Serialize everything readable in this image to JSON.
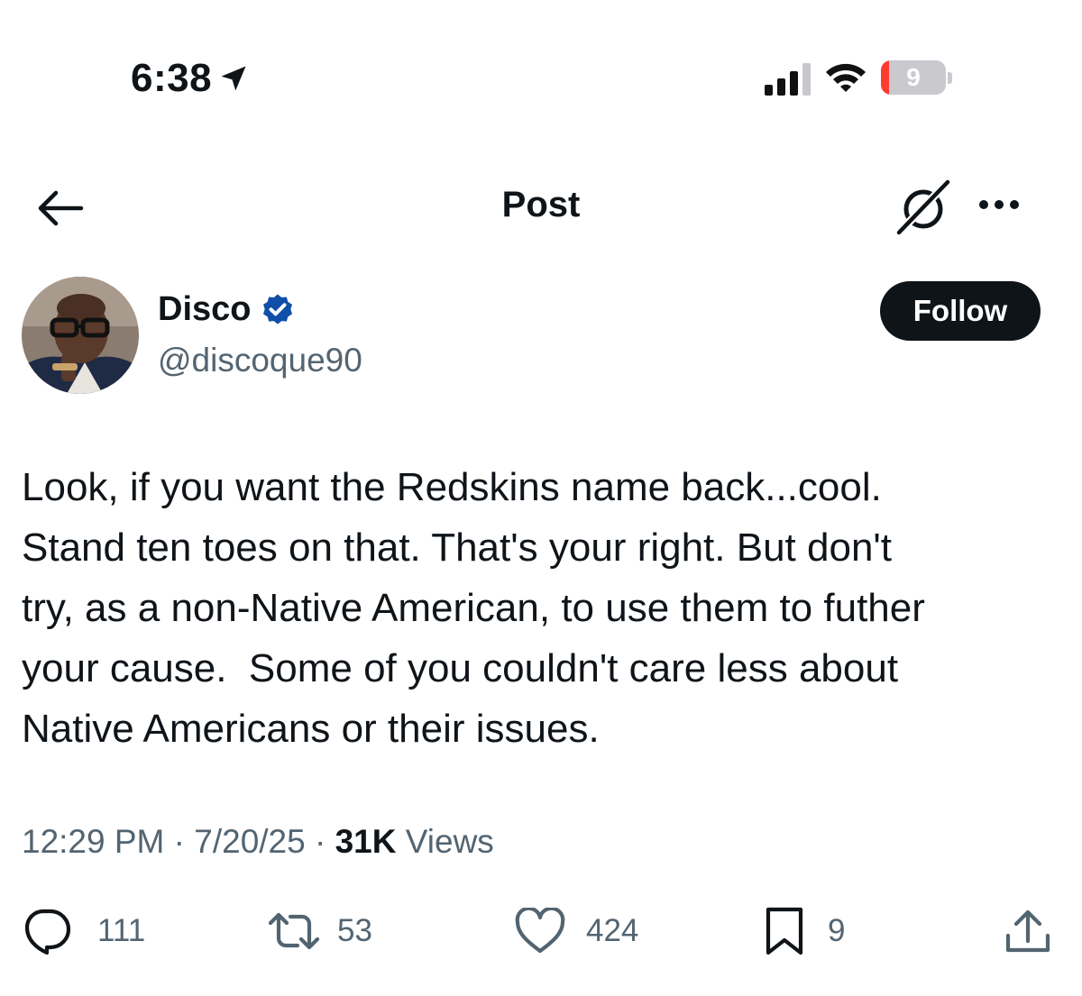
{
  "status_bar": {
    "time": "6:38",
    "battery_level": "9",
    "signal_bars_active": 3,
    "signal_bars_total": 4,
    "icons": [
      "location-arrow-icon",
      "cellular-signal-icon",
      "wifi-icon",
      "battery-icon"
    ]
  },
  "nav": {
    "title": "Post",
    "icons": [
      "back-arrow-icon",
      "grok-icon",
      "more-icon"
    ]
  },
  "author": {
    "name": "Disco",
    "handle": "@discoque90",
    "verified": true,
    "verified_color": "#0f4fa8"
  },
  "follow_button": {
    "label": "Follow"
  },
  "tweet": {
    "lines": [
      "Look, if you want the Redskins name back...cool.",
      "Stand ten toes on that. That's your right. But don't",
      "try, as a non-Native American, to use them to futher",
      "your cause.  Some of you couldn't care less about",
      "Native Americans or their issues."
    ]
  },
  "meta": {
    "time": "12:29 PM",
    "separator": " · ",
    "date": "7/20/25",
    "views_count": "31K",
    "views_label": " Views"
  },
  "actions": {
    "replies": "111",
    "reposts": "53",
    "likes": "424",
    "bookmarks": "9"
  },
  "colors": {
    "text_primary": "#0f1419",
    "text_secondary": "#536471",
    "battery_low": "#ff3b30"
  }
}
